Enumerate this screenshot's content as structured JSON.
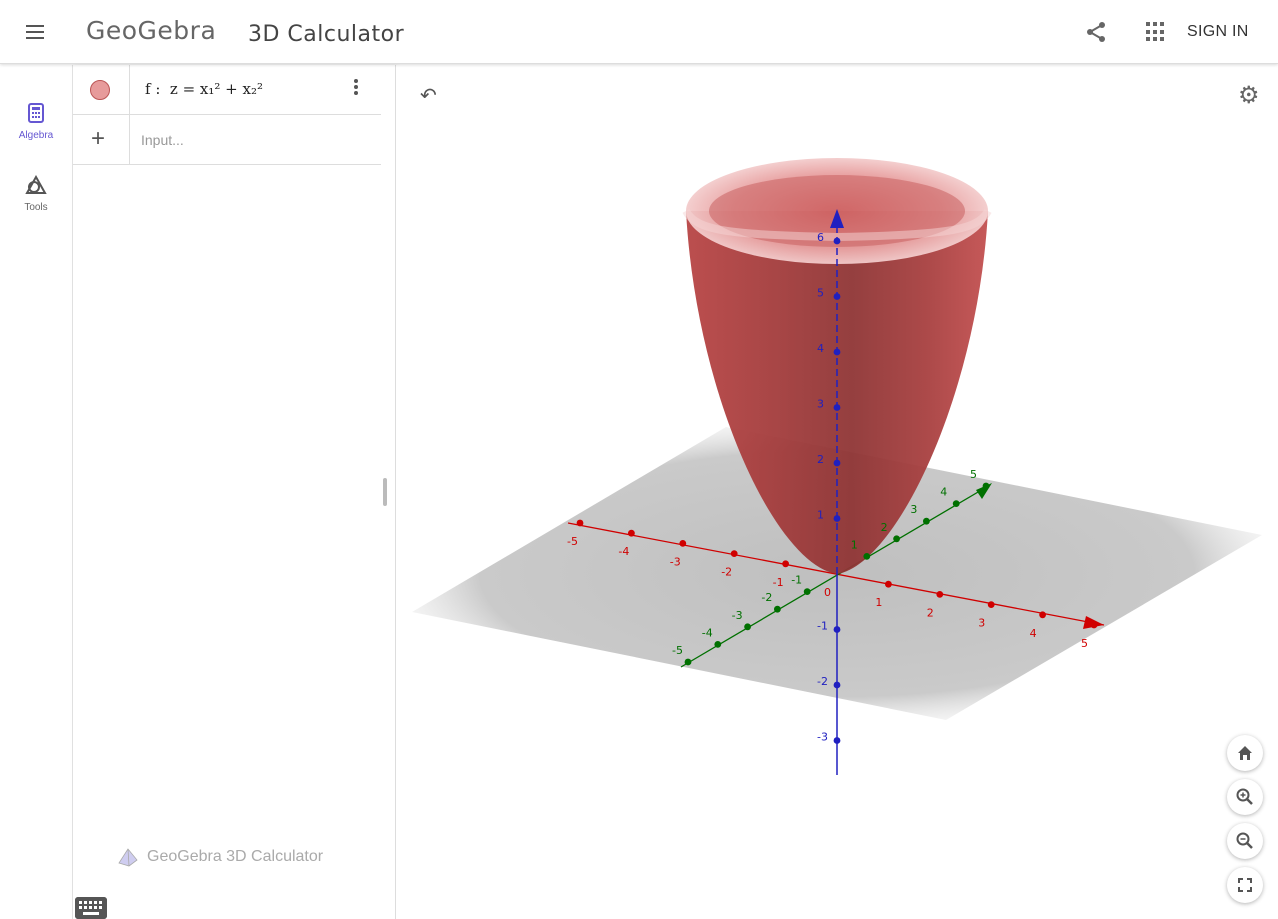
{
  "header": {
    "logo": "GeoGebra",
    "title": "3D Calculator",
    "sign_in": "SIGN IN"
  },
  "rail": {
    "algebra_label": "Algebra",
    "tools_label": "Tools"
  },
  "algebra": {
    "function_name": "f",
    "function_expr": "z = x₁² + x₂²",
    "input_placeholder": "Input...",
    "footer": "GeoGebra 3D Calculator"
  },
  "view3d": {
    "surface_color": "#c24040",
    "x_axis_color": "#d00000",
    "y_axis_color": "#007000",
    "z_axis_color": "#2020c0",
    "x_ticks": [
      "-5",
      "-4",
      "-3",
      "-2",
      "-1",
      "0",
      "1",
      "2",
      "3",
      "4",
      "5"
    ],
    "y_ticks": [
      "-5",
      "-4",
      "-3",
      "-2",
      "-1",
      "1",
      "2",
      "3",
      "4",
      "5"
    ],
    "z_ticks": [
      "-3",
      "-2",
      "-1",
      "1",
      "2",
      "3",
      "4",
      "5",
      "6"
    ],
    "controls": [
      "home-icon",
      "zoom-in-icon",
      "zoom-out-icon",
      "fullscreen-icon"
    ]
  }
}
